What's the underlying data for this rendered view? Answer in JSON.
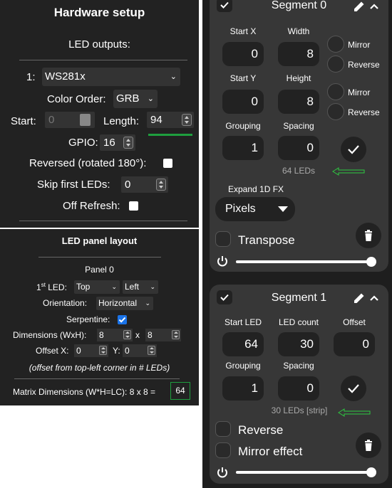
{
  "hardware": {
    "title": "Hardware setup",
    "subtitle": "LED outputs:",
    "output_index": "1:",
    "led_type": "WS281x",
    "color_order_label": "Color Order:",
    "color_order": "GRB",
    "start_label": "Start:",
    "start_value": "0",
    "length_label": "Length:",
    "length_value": "94",
    "gpio_label": "GPIO:",
    "gpio_value": "16",
    "reversed_label": "Reversed (rotated 180°):",
    "skip_label": "Skip first LEDs:",
    "skip_value": "0",
    "off_refresh_label": "Off Refresh:",
    "accent_green": "#1e9e3e"
  },
  "panel": {
    "title": "LED panel layout",
    "panel_name": "Panel 0",
    "first_led_prefix": "1",
    "first_led_sup": "st",
    "first_led_suffix": " LED:",
    "first_led_v": "Top",
    "first_led_h": "Left",
    "orientation_label": "Orientation:",
    "orientation": "Horizontal",
    "serpentine_label": "Serpentine:",
    "dimensions_label": "Dimensions (WxH):",
    "width": "8",
    "times": "x",
    "height": "8",
    "offset_x_label": "Offset X:",
    "offset_x": "0",
    "offset_y_label": "Y:",
    "offset_y": "0",
    "offset_note": "(offset from top-left corner in # LEDs)",
    "matrix_label": "Matrix Dimensions (W*H=LC): 8 x 8 =",
    "matrix_count": "64",
    "checkbox_color": "#1a73e8"
  },
  "segment0": {
    "title": "Segment 0",
    "start_x_label": "Start X",
    "start_x": "0",
    "width_label": "Width",
    "width": "8",
    "start_y_label": "Start Y",
    "start_y": "0",
    "height_label": "Height",
    "height": "8",
    "grouping_label": "Grouping",
    "grouping": "1",
    "spacing_label": "Spacing",
    "spacing": "0",
    "mirror_x_label": "Mirror",
    "reverse_x_label": "Reverse",
    "mirror_y_label": "Mirror",
    "reverse_y_label": "Reverse",
    "led_count_text": "64 LEDs",
    "expand_label": "Expand 1D FX",
    "expand_value": "Pixels",
    "transpose_label": "Transpose",
    "brightness": 1.0
  },
  "segment1": {
    "title": "Segment 1",
    "start_led_label": "Start LED",
    "start_led": "64",
    "led_count_label": "LED count",
    "led_count": "30",
    "offset_label": "Offset",
    "offset": "0",
    "grouping_label": "Grouping",
    "grouping": "1",
    "spacing_label": "Spacing",
    "spacing": "0",
    "led_count_text": "30 LEDs [strip]",
    "reverse_label": "Reverse",
    "mirror_label": "Mirror effect",
    "brightness": 1.0
  },
  "icons": {
    "edit": "pencil-icon",
    "collapse": "chevron-up-icon",
    "delete": "trash-icon",
    "apply": "checkmark-icon",
    "power": "power-icon",
    "annotation_arrow": "green-arrow-left"
  }
}
